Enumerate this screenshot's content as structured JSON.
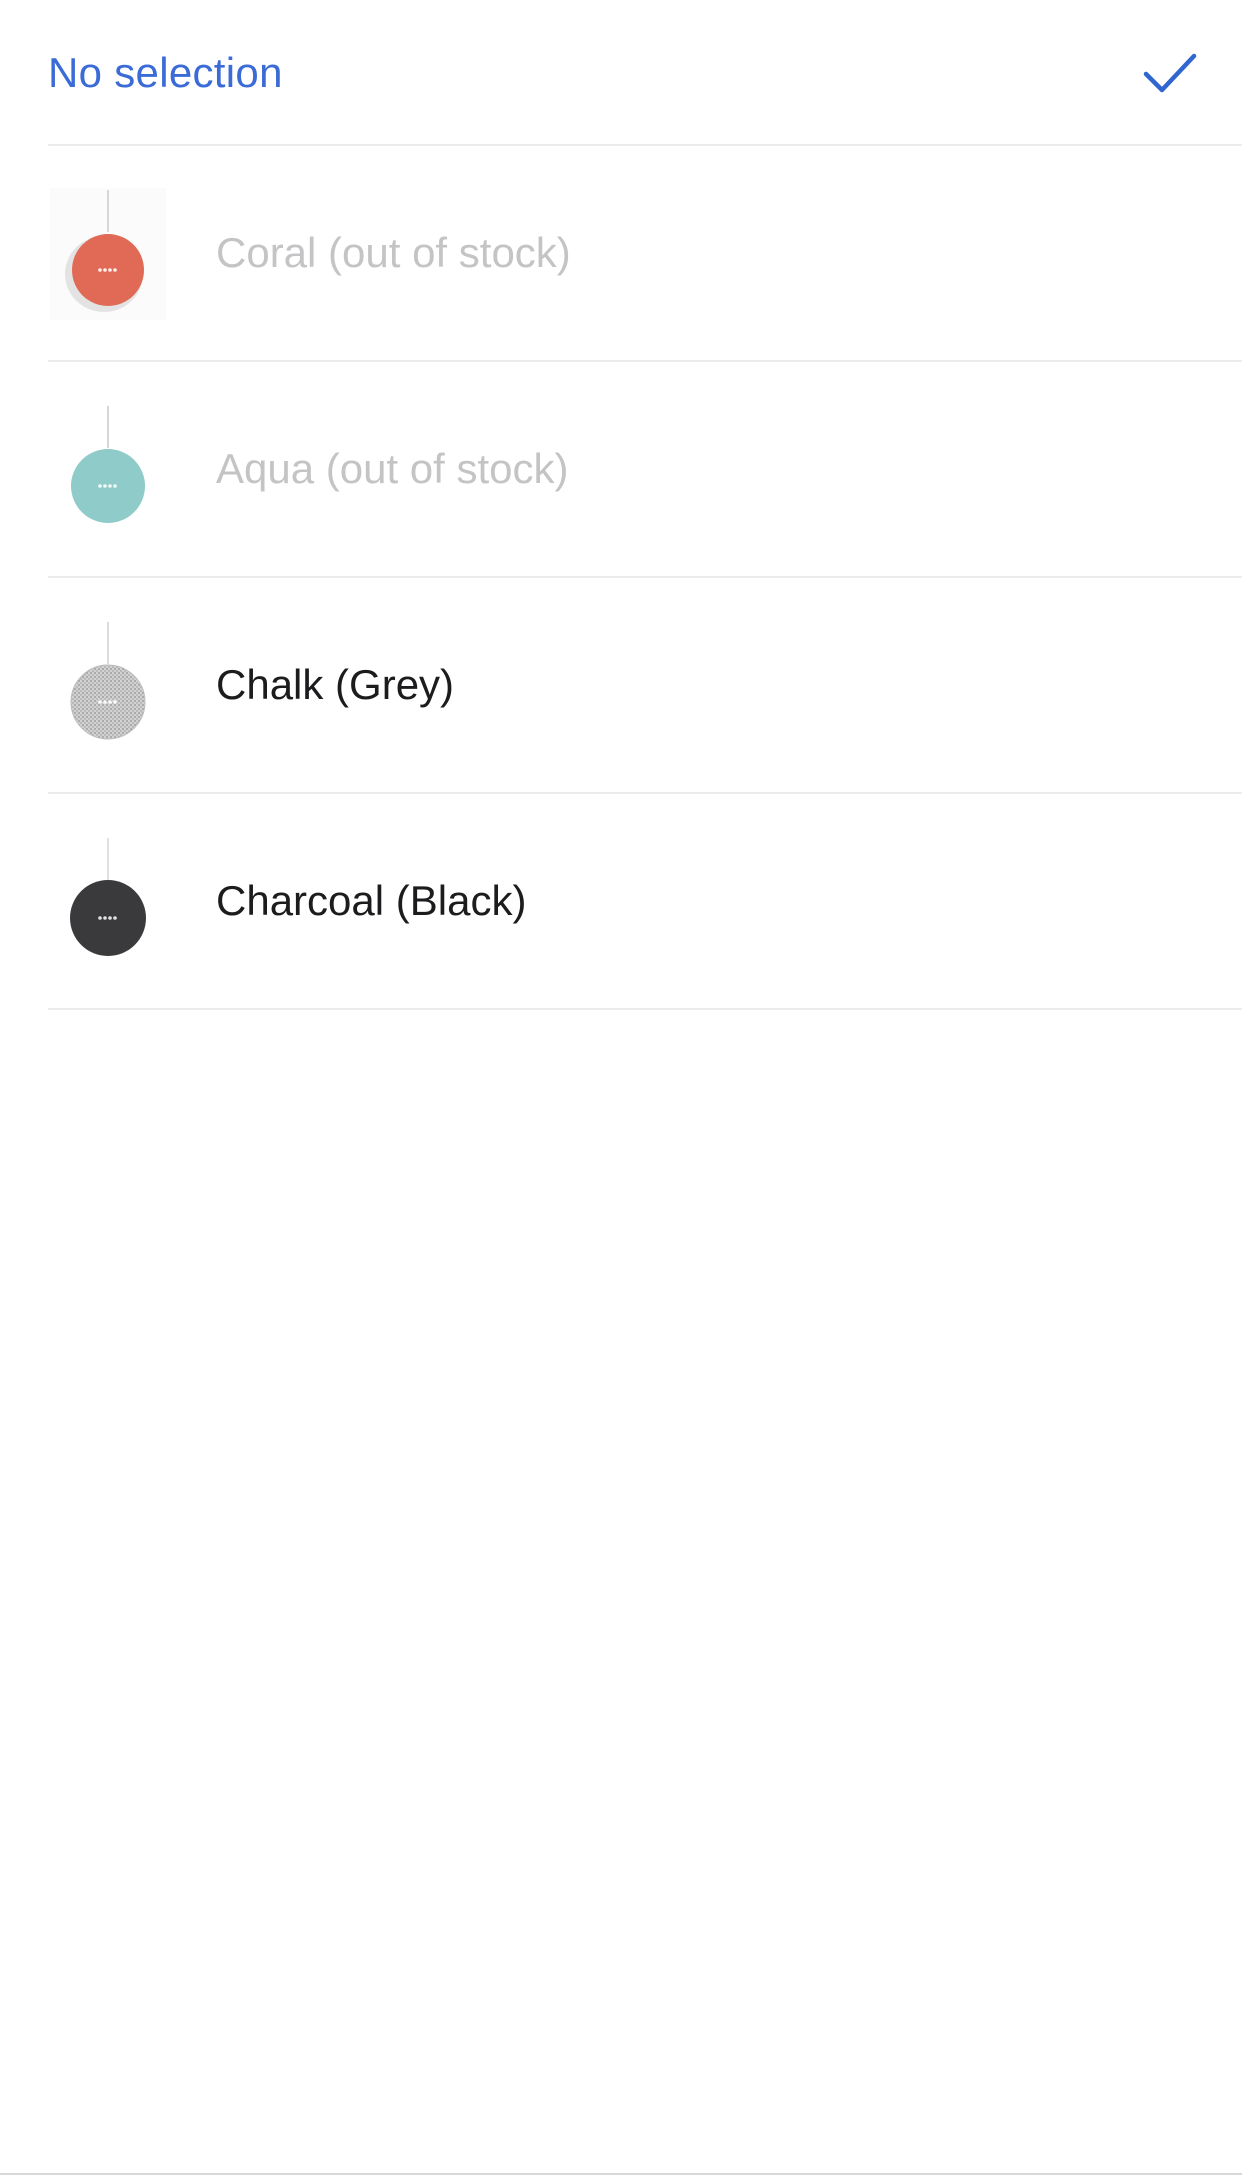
{
  "header": {
    "no_selection_label": "No selection",
    "confirm_icon": "checkmark-icon",
    "accent_color": "#3a6bd6"
  },
  "options": [
    {
      "label": "Coral (out of stock)",
      "available": false,
      "swatch_color": "#e26a55",
      "icon": "speaker-thumbnail"
    },
    {
      "label": "Aqua (out of stock)",
      "available": false,
      "swatch_color": "#8ccbc8",
      "icon": "speaker-thumbnail"
    },
    {
      "label": "Chalk (Grey)",
      "available": true,
      "swatch_color": "#c9c9c9",
      "icon": "speaker-thumbnail"
    },
    {
      "label": "Charcoal (Black)",
      "available": true,
      "swatch_color": "#3b3b3d",
      "icon": "speaker-thumbnail"
    }
  ]
}
